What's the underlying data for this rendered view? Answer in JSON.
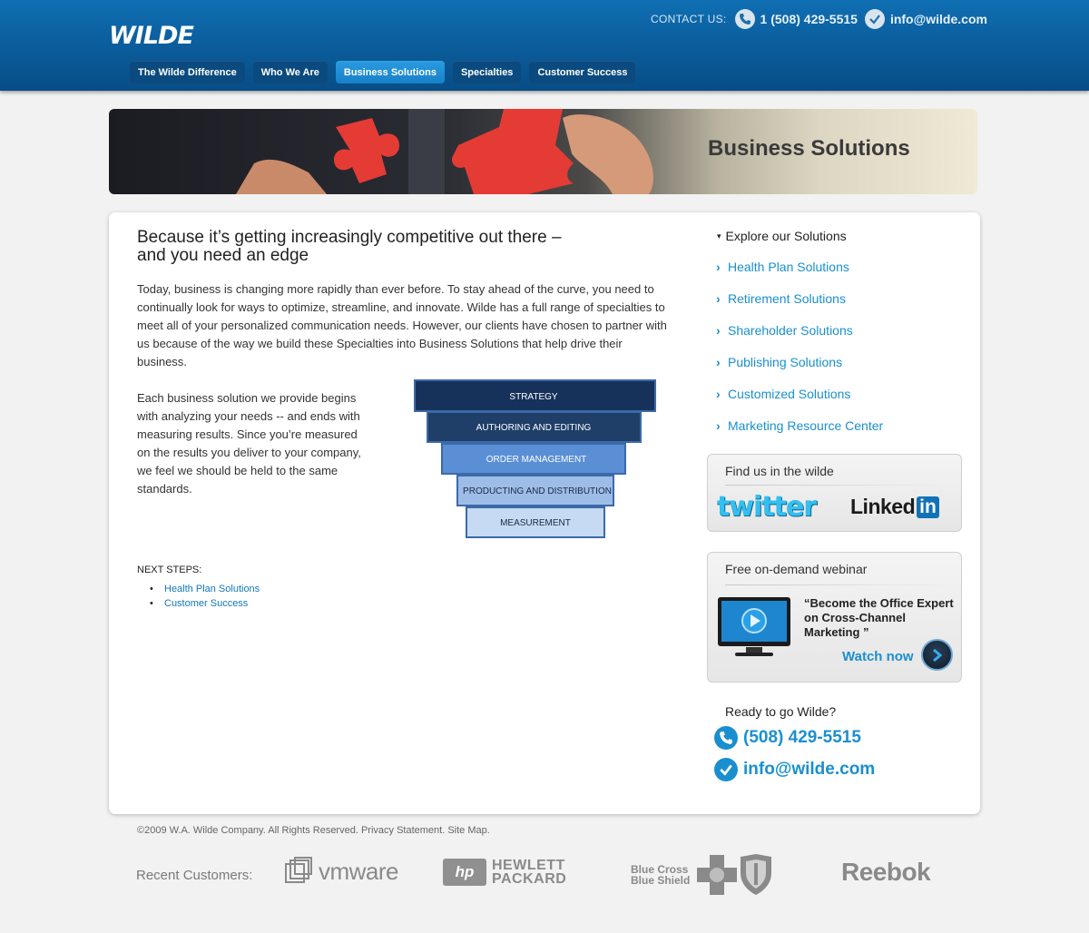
{
  "header": {
    "logo_text": "WILDE",
    "contact_label": "CONTACT US:",
    "phone": "1 (508) 429-5515",
    "email": "info@wilde.com"
  },
  "nav": {
    "tabs": [
      {
        "label": "The Wilde Difference",
        "active": false
      },
      {
        "label": "Who We Are",
        "active": false
      },
      {
        "label": "Business Solutions",
        "active": true
      },
      {
        "label": "Specialties",
        "active": false
      },
      {
        "label": "Customer Success",
        "active": false
      }
    ]
  },
  "banner": {
    "title": "Business Solutions"
  },
  "main": {
    "headline_line1": "Because it’s getting increasingly competitive out there –",
    "headline_line2": "and you need an edge",
    "paragraph1": "Today, business is changing more rapidly than ever before. To stay ahead of the curve, you need to continually look for ways to optimize, streamline, and innovate. Wilde has a full range of specialties to meet all of your personalized communication needs. However, our clients have chosen to partner with us because of the way we build these Specialties into Business Solutions that help drive their business.",
    "paragraph2": "Each business solution we provide begins with analyzing your needs -- and ends with measuring results. Since you’re measured on the results you deliver to your company, we feel we should be held to the same standards.",
    "pyramid": [
      {
        "label": "STRATEGY",
        "color": "#17325a"
      },
      {
        "label": "AUTHORING AND EDITING",
        "color": "#1f3f69"
      },
      {
        "label": "ORDER MANAGEMENT",
        "color": "#5a8fd6"
      },
      {
        "label": "PRODUCTING AND DISTRIBUTION",
        "color": "#9dbde8"
      },
      {
        "label": "MEASUREMENT",
        "color": "#c7daf3"
      }
    ],
    "next_steps_title": "NEXT STEPS:",
    "next_steps": [
      "Health Plan Solutions",
      "Customer Success"
    ],
    "bullet": "•"
  },
  "sidebar": {
    "explore_title": "Explore our Solutions",
    "explore_marker": "▾",
    "chevron": "›",
    "solutions": [
      "Health Plan Solutions",
      "Retirement Solutions",
      "Shareholder Solutions",
      "Publishing Solutions",
      "Customized Solutions",
      "Marketing Resource Center"
    ],
    "social_title": "Find us in the wilde",
    "twitter_label": "twitter",
    "linkedin_label_a": "Linked",
    "linkedin_label_b": "in",
    "webinar_title": "Free on-demand webinar",
    "webinar_quote": "“Become the Office Expert on Cross-Channel Marketing ”",
    "watch_label": "Watch now",
    "ready_title": "Ready to go Wilde?",
    "ready_phone": "(508) 429-5515",
    "ready_email": "info@wilde.com"
  },
  "footer": {
    "copyright": "©2009 W.A. Wilde Company. All Rights Reserved. Privacy Statement. Site Map.",
    "recent_label": "Recent Customers:",
    "customers": {
      "vmware": "vmware",
      "hp_line1": "HEWLETT",
      "hp_line2": "PACKARD",
      "hp_badge": "hp",
      "bcbs_line1": "Blue Cross",
      "bcbs_line2": "Blue Shield",
      "reebok": "Reebok"
    }
  },
  "colors": {
    "header_blue": "#0b5f9e",
    "nav_active": "#1780c9",
    "link_blue": "#1a8fd0",
    "twitter_blue": "#33bff0",
    "linkedin_blue": "#1172b5"
  }
}
